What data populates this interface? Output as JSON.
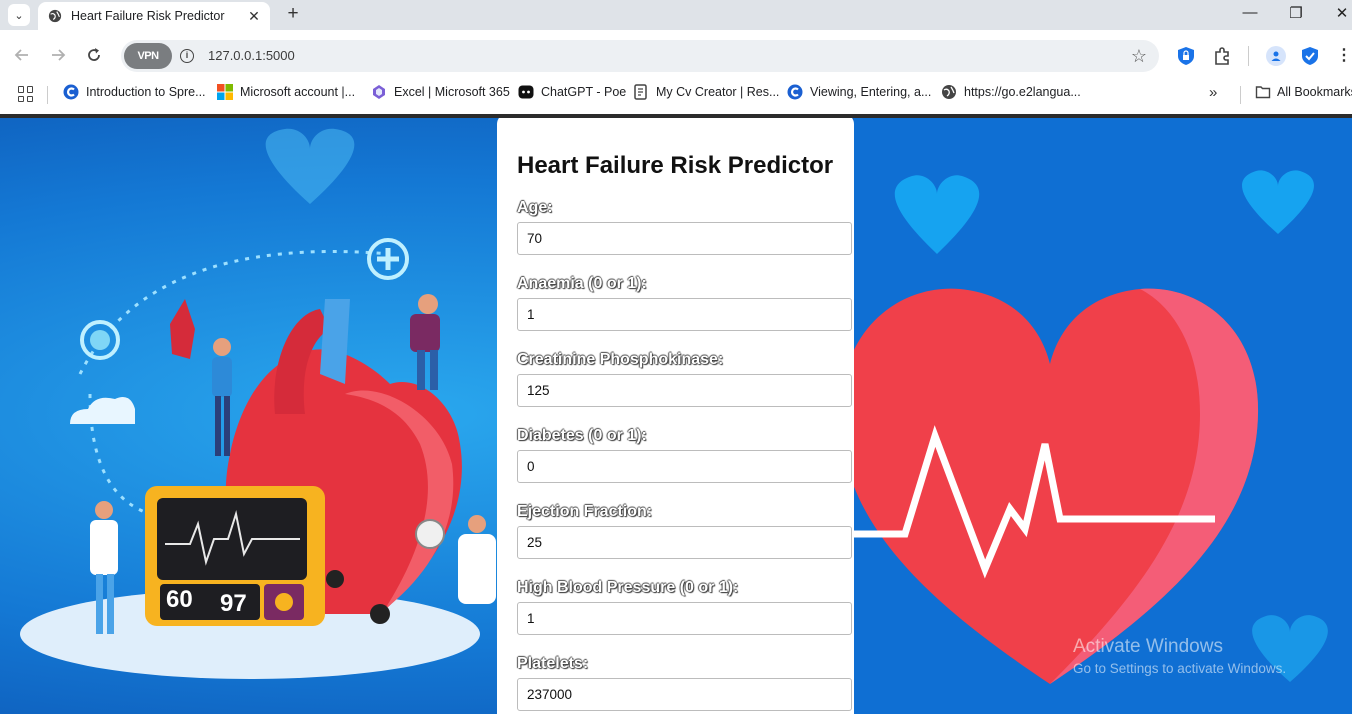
{
  "browser": {
    "tab_title": "Heart Failure Risk Predictor",
    "url": "127.0.0.1:5000",
    "vpn_label": "VPN",
    "bookmarks": [
      {
        "label": "Introduction to Spre...",
        "icon": "c-logo-icon"
      },
      {
        "label": "Microsoft account |...",
        "icon": "microsoft-logo-icon"
      },
      {
        "label": "Excel | Microsoft 365",
        "icon": "m365-logo-icon"
      },
      {
        "label": "ChatGPT - Poe",
        "icon": "poe-logo-icon"
      },
      {
        "label": "My Cv Creator | Res...",
        "icon": "document-icon"
      },
      {
        "label": "Viewing, Entering, a...",
        "icon": "c-logo-icon"
      },
      {
        "label": "https://go.e2langua...",
        "icon": "globe-icon"
      }
    ],
    "all_bookmarks_label": "All Bookmarks"
  },
  "form": {
    "title": "Heart Failure Risk Predictor",
    "fields": [
      {
        "label": "Age:",
        "value": "70"
      },
      {
        "label": "Anaemia (0 or 1):",
        "value": "1"
      },
      {
        "label": "Creatinine Phosphokinase:",
        "value": "125"
      },
      {
        "label": "Diabetes (0 or 1):",
        "value": "0"
      },
      {
        "label": "Ejection Fraction:",
        "value": "25"
      },
      {
        "label": "High Blood Pressure (0 or 1):",
        "value": "1"
      },
      {
        "label": "Platelets:",
        "value": "237000"
      }
    ]
  },
  "monitor": {
    "left_reading": "60",
    "right_reading": "97"
  },
  "watermark": {
    "line1": "Activate Windows",
    "line2": "Go to Settings to activate Windows."
  },
  "colors": {
    "page_bg": "#1478d4",
    "heart_red": "#f0404a",
    "card_bg": "#ffffff"
  }
}
